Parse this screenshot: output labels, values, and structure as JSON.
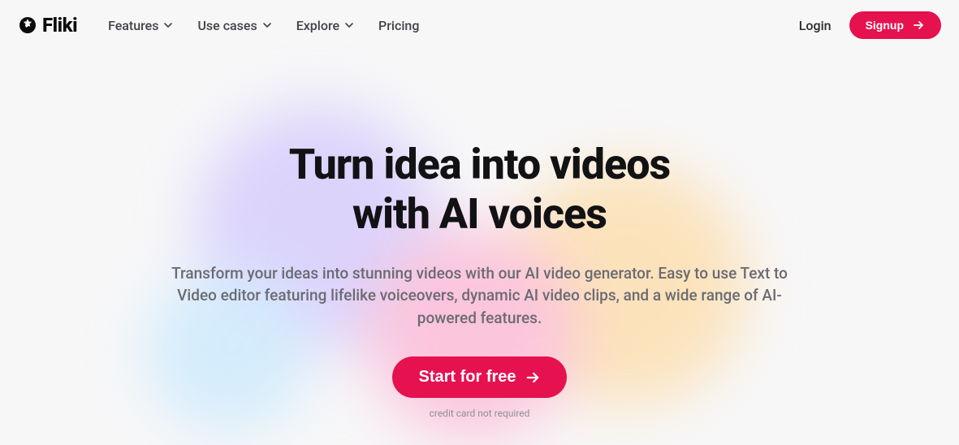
{
  "brand": {
    "name": "Fliki"
  },
  "nav": {
    "items": [
      {
        "label": "Features"
      },
      {
        "label": "Use cases"
      },
      {
        "label": "Explore"
      },
      {
        "label": "Pricing"
      }
    ]
  },
  "auth": {
    "login": "Login",
    "signup": "Signup"
  },
  "hero": {
    "title_line1": "Turn idea into videos",
    "title_line2": "with AI voices",
    "subtitle": "Transform your ideas into stunning videos with our AI video generator. Easy to use Text to Video editor featuring lifelike voiceovers, dynamic AI video clips, and a wide range of AI-powered features.",
    "cta": "Start for free",
    "note": "credit card not required"
  },
  "colors": {
    "accent": "#e6114f"
  }
}
